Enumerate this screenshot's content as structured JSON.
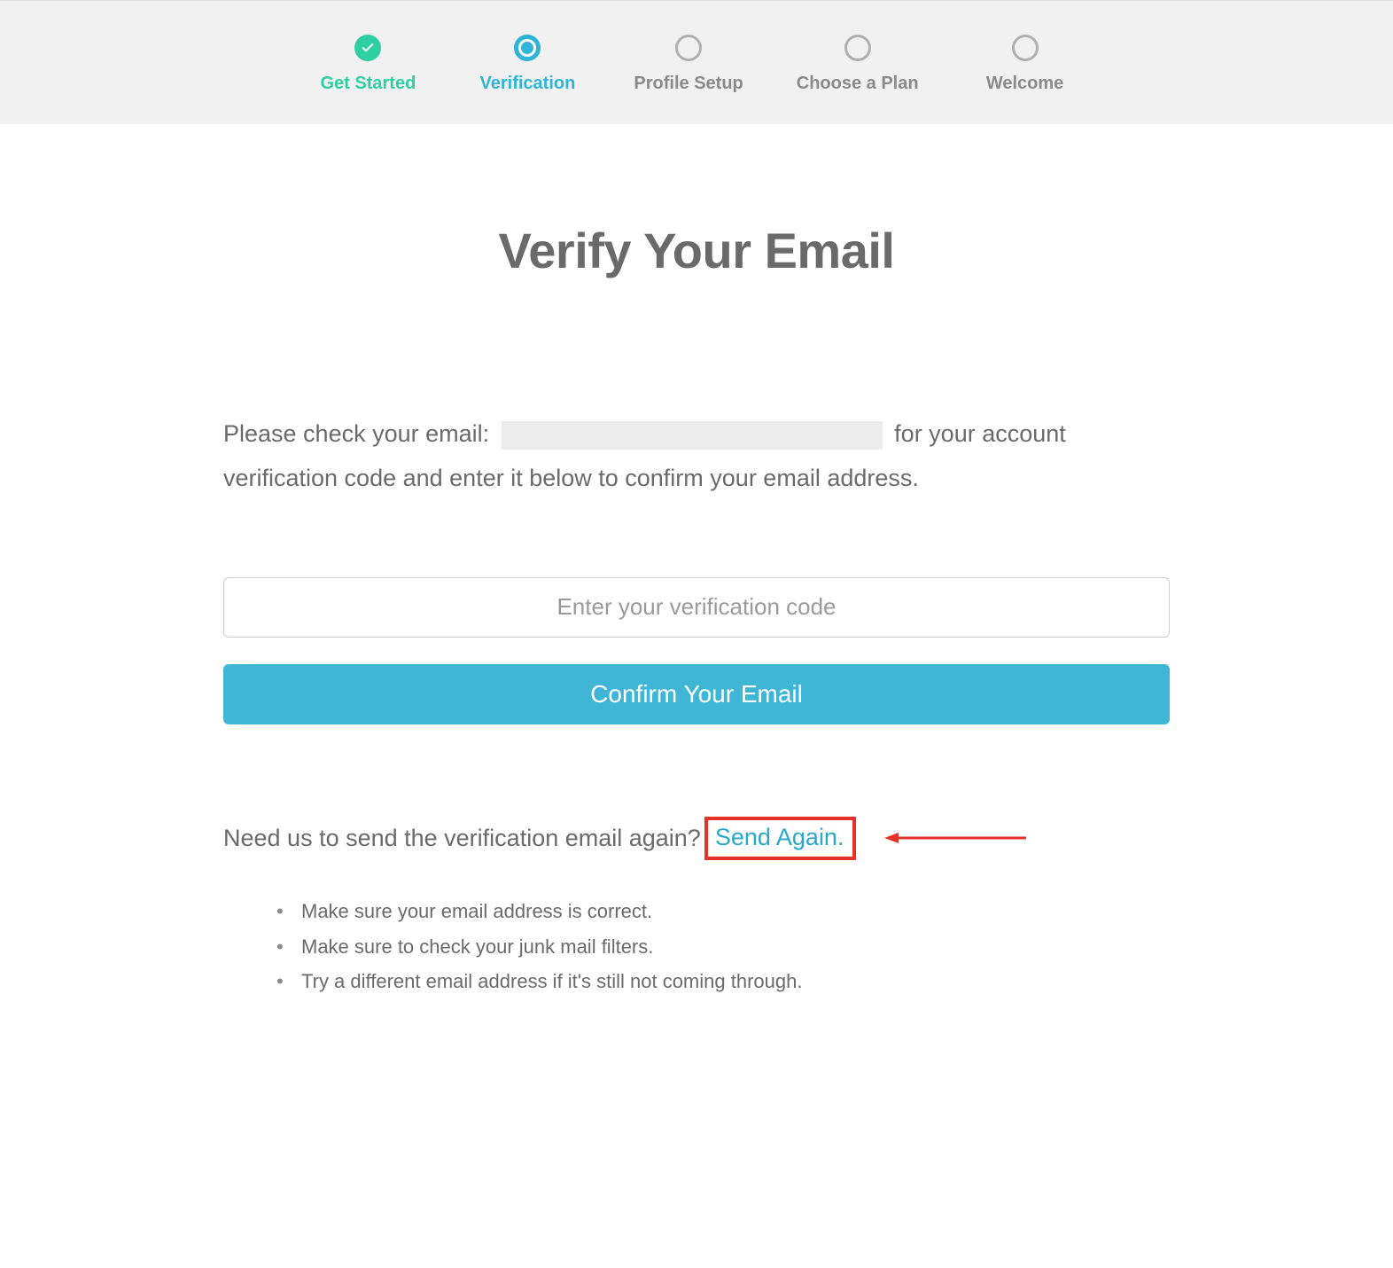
{
  "stepper": {
    "items": [
      {
        "label": "Get Started",
        "state": "completed"
      },
      {
        "label": "Verification",
        "state": "active"
      },
      {
        "label": "Profile Setup",
        "state": "inactive"
      },
      {
        "label": "Choose a Plan",
        "state": "inactive"
      },
      {
        "label": "Welcome",
        "state": "inactive"
      }
    ]
  },
  "main": {
    "title": "Verify Your Email",
    "instruction_pre": "Please check your email:",
    "instruction_post": "for your account verification code and enter it below to confirm your email address.",
    "email_value": "",
    "code_placeholder": "Enter your verification code",
    "confirm_label": "Confirm Your Email",
    "resend_prompt": "Need us to send the verification email again?",
    "resend_link": "Send Again.",
    "tips": [
      "Make sure your email address is correct.",
      "Make sure to check your junk mail filters.",
      "Try a different email address if it's still not coming through."
    ]
  },
  "colors": {
    "accent_teal": "#2ecfa3",
    "accent_blue": "#2fb4d8",
    "button_blue": "#3fb6d6",
    "annotation_red": "#e63228",
    "text_gray": "#6a6a6a"
  }
}
